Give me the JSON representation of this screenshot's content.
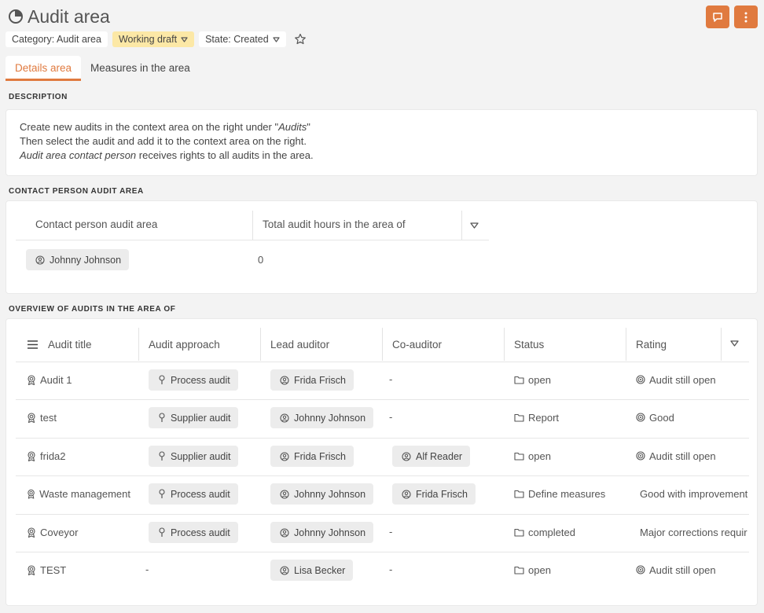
{
  "header": {
    "title": "Audit area",
    "chips": [
      {
        "label": "Category: Audit area",
        "type": "plain"
      },
      {
        "label": "Working draft",
        "type": "draft"
      },
      {
        "label": "State: Created",
        "type": "plain"
      }
    ]
  },
  "tabs": [
    {
      "label": "Details area",
      "active": true
    },
    {
      "label": "Measures in the area",
      "active": false
    }
  ],
  "description": {
    "section_label": "DESCRIPTION",
    "line1_pre": "Create new audits in the context area on the right under \"",
    "line1_em": "Audits",
    "line1_post": "\"",
    "line2": "Then select the audit and add it to the context area on the right.",
    "line3_em": "Audit area contact person",
    "line3_post": " receives rights to all audits in the area."
  },
  "contact": {
    "section_label": "CONTACT PERSON AUDIT AREA",
    "columns": [
      "Contact person audit area",
      "Total audit hours in the area of"
    ],
    "person": "Johnny Johnson",
    "hours": "0"
  },
  "overview": {
    "section_label": "OVERVIEW OF AUDITS IN THE AREA OF",
    "columns": [
      "Audit title",
      "Audit approach",
      "Lead auditor",
      "Co-auditor",
      "Status",
      "Rating"
    ],
    "rows": [
      {
        "title": "Audit 1",
        "approach": "Process audit",
        "lead": "Frida Frisch",
        "co": "-",
        "status": "open",
        "rating": "Audit still open"
      },
      {
        "title": "test",
        "approach": "Supplier audit",
        "lead": "Johnny Johnson",
        "co": "-",
        "status": "Report",
        "rating": "Good"
      },
      {
        "title": "frida2",
        "approach": "Supplier audit",
        "lead": "Frida Frisch",
        "co": "Alf Reader",
        "status": "open",
        "rating": "Audit still open"
      },
      {
        "title": "Waste management",
        "approach": "Process audit",
        "lead": "Johnny Johnson",
        "co": "Frida Frisch",
        "status": "Define measures",
        "rating": "Good with improvements"
      },
      {
        "title": "Coveyor",
        "approach": "Process audit",
        "lead": "Johnny Johnson",
        "co": "-",
        "status": "completed",
        "rating": "Major corrections required"
      },
      {
        "title": "TEST",
        "approach": "-",
        "lead": "Lisa Becker",
        "co": "-",
        "status": "open",
        "rating": "Audit still open"
      }
    ]
  },
  "colors": {
    "accent": "#e07a3f",
    "draft_chip": "#fce8a6",
    "background": "#f3f3f3"
  },
  "icons": [
    "pie-chart-icon",
    "chat-icon",
    "more-vertical-icon",
    "star-icon",
    "caret-down-icon",
    "user-circle-icon",
    "hamburger-menu-icon",
    "award-icon",
    "pin-icon",
    "folder-icon",
    "target-icon"
  ]
}
